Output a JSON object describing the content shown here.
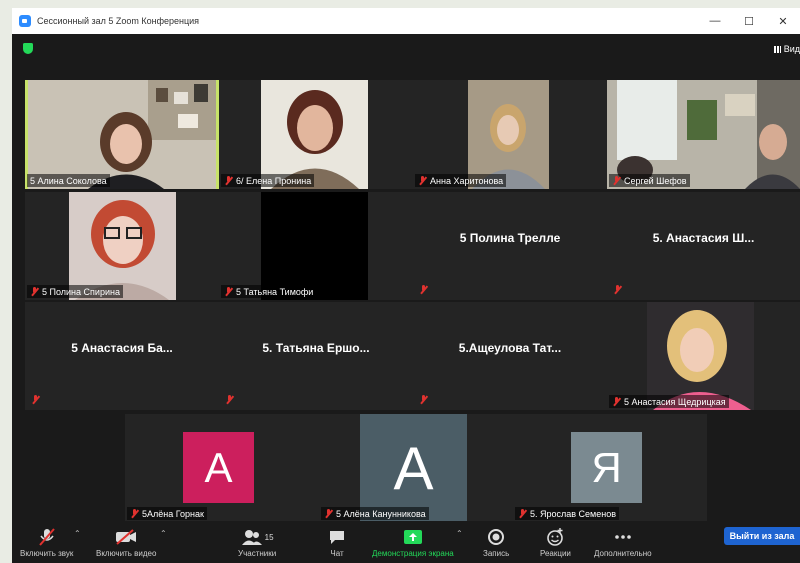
{
  "window": {
    "title": "Сессионный зал 5   Zoom Конференция",
    "minimize": "—",
    "maximize": "☐",
    "close": "✕"
  },
  "topbar": {
    "view_label": "Вид"
  },
  "participants": [
    {
      "name": "5 Алина Соколова"
    },
    {
      "name": "6/ Елена Пронина"
    },
    {
      "name": "Анна Харитонова"
    },
    {
      "name": "Сергей Шефов"
    },
    {
      "name": "5 Полина Спирина"
    },
    {
      "name": "5 Татьяна Тимофи"
    },
    {
      "name": "5 Полина Трелле"
    },
    {
      "name": "5. Анастасия Ш..."
    },
    {
      "name": "5 Анастасия Ба..."
    },
    {
      "name": "5. Татьяна Ершо..."
    },
    {
      "name": "5.Ащеулова  Тат..."
    },
    {
      "name": "5 Анастасия Щедрицкая"
    },
    {
      "name": "5Алёна Горнак",
      "avatar": "A",
      "avatar_color": "#cc1f5d"
    },
    {
      "name": "5 Алёна Канунникова",
      "avatar": "A",
      "avatar_color": "#4b5d66"
    },
    {
      "name": "5. Ярослав Семенов",
      "avatar": "Я",
      "avatar_color": "#7b8a91"
    }
  ],
  "toolbar": {
    "audio_label": "Включить звук",
    "video_label": "Включить видео",
    "participants_label": "Участники",
    "participants_count": "15",
    "chat_label": "Чат",
    "share_label": "Демонстрация экрана",
    "record_label": "Запись",
    "reactions_label": "Реакции",
    "more_label": "Дополнительно",
    "leave_label": "Выйти из зала",
    "caret": "⌃"
  },
  "colors": {
    "active_speaker": "#c7e26a",
    "share_green": "#23d959",
    "leave_blue": "#1e64d1",
    "muted_red": "#e0322f"
  }
}
